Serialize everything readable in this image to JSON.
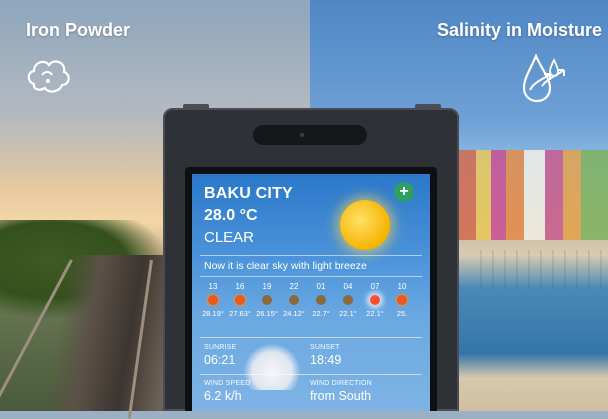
{
  "banner": {
    "left_label": "Iron Powder",
    "right_label": "Salinity in Moisture",
    "left_icon": "powder-cloud-icon",
    "right_icon": "water-drops-arrows-icon"
  },
  "weather": {
    "city": "BAKU CITY",
    "temperature": "28.0 °C",
    "condition": "CLEAR",
    "summary": "Now it is clear sky with light breeze",
    "add_icon": "plus-icon",
    "add_label": "+",
    "hourly": [
      {
        "hour": "13",
        "temp": "28.19°",
        "icon": "sun-icon"
      },
      {
        "hour": "16",
        "temp": "27.63°",
        "icon": "sun-icon"
      },
      {
        "hour": "19",
        "temp": "26.15°",
        "icon": "moon-icon"
      },
      {
        "hour": "22",
        "temp": "24.12°",
        "icon": "moon-icon"
      },
      {
        "hour": "01",
        "temp": "22.7°",
        "icon": "moon-icon"
      },
      {
        "hour": "04",
        "temp": "22.1°",
        "icon": "moon-icon"
      },
      {
        "hour": "07",
        "temp": "22.1°",
        "icon": "sun-icon"
      },
      {
        "hour": "10",
        "temp": "25.",
        "icon": "sun-icon"
      }
    ],
    "sunrise_label": "SUNRISE",
    "sunrise": "06:21",
    "sunset_label": "SUNSET",
    "sunset": "18:49",
    "wind_speed_label": "WIND SPEED",
    "wind_speed": "6.2 k/h",
    "wind_direction_label": "WIND DIRECTION",
    "wind_direction": "from South"
  }
}
